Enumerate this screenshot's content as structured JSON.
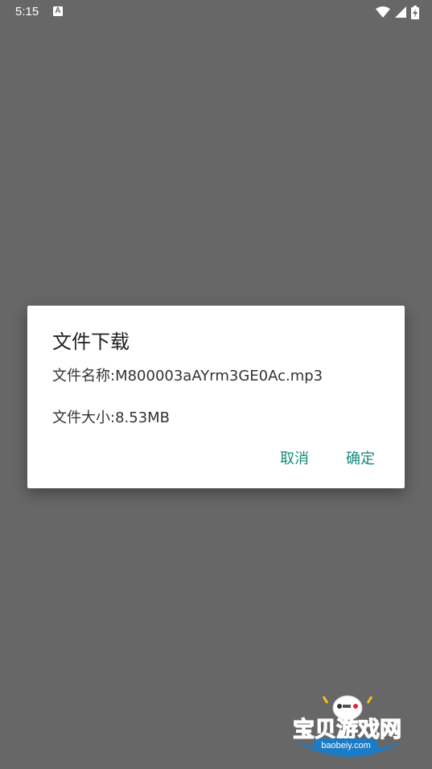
{
  "status_bar": {
    "time": "5:15",
    "notification_icon": "a-icon",
    "wifi_icon": "wifi-icon",
    "signal_icon": "signal-icon",
    "battery_icon": "battery-charging-icon"
  },
  "dialog": {
    "title": "文件下载",
    "file_name": "文件名称:M800003aAYrm3GE0Ac.mp3",
    "file_size": "文件大小:8.53MB",
    "cancel_label": "取消",
    "ok_label": "确定",
    "accent_color": "#128a7d"
  },
  "watermark": {
    "title": "宝贝游戏网",
    "url": "baobeiy.com"
  },
  "colors": {
    "overlay_background": "#676767",
    "dialog_background": "#ffffff"
  }
}
